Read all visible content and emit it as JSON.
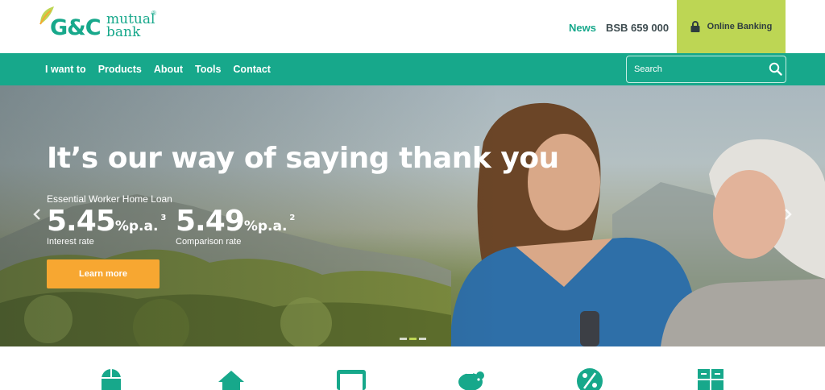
{
  "brand": {
    "logo_initials": "G&C",
    "logo_word1": "mutual",
    "logo_word2": "bank",
    "registered_mark": "®",
    "primary_color": "#17a88b",
    "accent_color": "#bdd654",
    "cta_color": "#f7a731"
  },
  "header": {
    "news_label": "News",
    "bsb_text": "BSB 659 000",
    "online_banking_label": "Online Banking",
    "online_banking_icon": "lock-icon"
  },
  "nav": {
    "items": [
      {
        "label": "I want to"
      },
      {
        "label": "Products"
      },
      {
        "label": "About"
      },
      {
        "label": "Tools"
      },
      {
        "label": "Contact"
      }
    ],
    "search": {
      "placeholder": "Search",
      "value": "",
      "icon": "search-icon"
    }
  },
  "hero": {
    "headline": "It’s our way of saying thank you",
    "product_name": "Essential Worker Home Loan",
    "rates": [
      {
        "value": "5.45",
        "unit": "%p.a.",
        "footnote": "3",
        "label": "Interest rate"
      },
      {
        "value": "5.49",
        "unit": "%p.a.",
        "footnote": "2",
        "label": "Comparison rate"
      }
    ],
    "cta_label": "Learn more",
    "carousel": {
      "slide_count": 3,
      "active_slide": 2,
      "prev_icon": "chevron-left-icon",
      "next_icon": "chevron-right-icon"
    }
  },
  "features": {
    "icons": [
      "mouse-icon",
      "house-icon",
      "credit-card-icon",
      "piggy-bank-icon",
      "percent-icon",
      "calculator-icon"
    ]
  }
}
